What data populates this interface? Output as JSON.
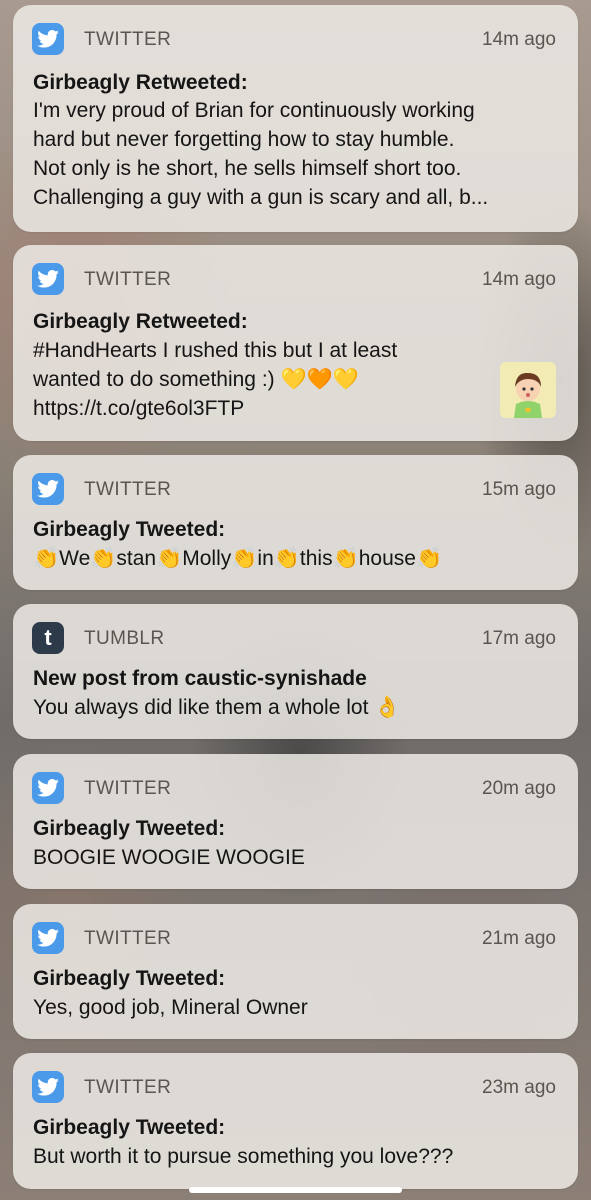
{
  "notifications": [
    {
      "app": "TWITTER",
      "icon": "twitter-bird-icon",
      "time": "14m ago",
      "title": "Girbeagly Retweeted:",
      "lines": [
        "I'm very proud of Brian for continuously working",
        "hard but never forgetting how to stay humble.",
        "Not only is he short, he sells himself short too.",
        "Challenging a guy with a gun is scary and all, b..."
      ]
    },
    {
      "app": "TWITTER",
      "icon": "twitter-bird-icon",
      "time": "14m ago",
      "title": "Girbeagly Retweeted:",
      "lines": [
        "#HandHearts I rushed this but I at least",
        "wanted to do something :) 💛🧡💛",
        "https://t.co/gte6ol3FTP"
      ],
      "thumbnail": "cartoon-avatar-thumbnail"
    },
    {
      "app": "TWITTER",
      "icon": "twitter-bird-icon",
      "time": "15m ago",
      "title": "Girbeagly Tweeted:",
      "lines": [
        "👏We👏stan👏Molly👏in👏this👏house👏"
      ]
    },
    {
      "app": "TUMBLR",
      "icon": "tumblr-t-icon",
      "time": "17m ago",
      "title": "New post from caustic-synishade",
      "lines": [
        "You always did like them a whole lot 👌"
      ]
    },
    {
      "app": "TWITTER",
      "icon": "twitter-bird-icon",
      "time": "20m ago",
      "title": "Girbeagly Tweeted:",
      "lines": [
        "BOOGIE WOOGIE WOOGIE"
      ]
    },
    {
      "app": "TWITTER",
      "icon": "twitter-bird-icon",
      "time": "21m ago",
      "title": "Girbeagly Tweeted:",
      "lines": [
        "Yes, good job, Mineral Owner"
      ]
    },
    {
      "app": "TWITTER",
      "icon": "twitter-bird-icon",
      "time": "23m ago",
      "title": "Girbeagly Tweeted:",
      "lines": [
        "But worth it to pursue something you love???"
      ]
    }
  ],
  "colors": {
    "twitter": "#4a9ae9",
    "tumblr": "#2c3a4a",
    "card": "#ece9e4"
  }
}
